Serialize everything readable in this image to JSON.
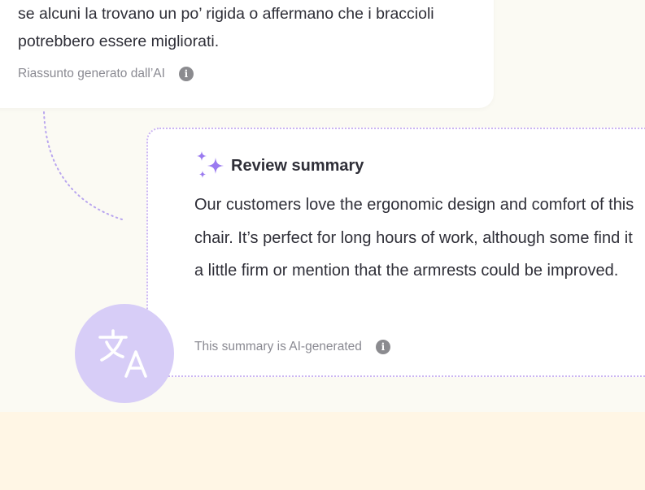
{
  "original_review": {
    "text": "se alcuni la trovano un po’ rigida o affermano che i braccioli potrebbero essere migliorati.",
    "ai_note": "Riassunto generato dall’AI",
    "info_icon": "info-icon"
  },
  "translated_review": {
    "title": "Review summary",
    "title_icon": "sparkle-icon",
    "text": "Our customers love the ergonomic design and comfort of this chair. It’s perfect for long hours of work, although some find it a little firm or mention that the armrests could be improved.",
    "ai_note": "This summary is AI-generated",
    "info_icon": "info-icon"
  },
  "translate_badge": {
    "icon": "translate-icon"
  },
  "colors": {
    "page_background": "#fbfaf3",
    "bottom_band": "#fff6e5",
    "card_background": "#ffffff",
    "accent_purple": "#9a7af0",
    "badge_purple": "#d7cdf7",
    "text_primary": "#2f2f38",
    "text_muted": "#8a8a92"
  }
}
